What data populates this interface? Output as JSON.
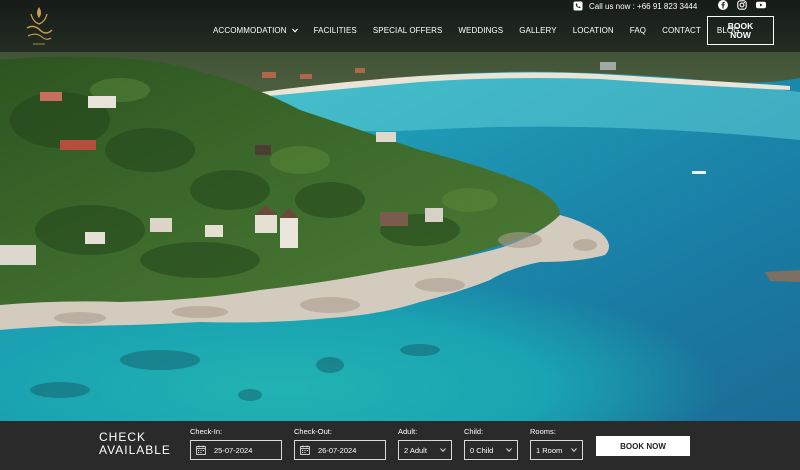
{
  "header": {
    "phone_text": "Call us now : +66 91 823 3444",
    "book_now_label": "BOOK\nNOW",
    "nav": [
      {
        "label": "ACCOMMODATION",
        "has_dropdown": true
      },
      {
        "label": "FACILITIES"
      },
      {
        "label": "SPECIAL OFFERS"
      },
      {
        "label": "WEDDINGS"
      },
      {
        "label": "GALLERY"
      },
      {
        "label": "LOCATION"
      },
      {
        "label": "FAQ"
      },
      {
        "label": "CONTACT"
      },
      {
        "label": "BLOG"
      }
    ],
    "socials": [
      "facebook-icon",
      "instagram-icon",
      "youtube-icon"
    ]
  },
  "booking": {
    "title": "CHECK\nAVAILABLE",
    "check_in": {
      "label": "Check-In:",
      "value": "25-07-2024"
    },
    "check_out": {
      "label": "Check-Out:",
      "value": "26-07-2024"
    },
    "adult": {
      "label": "Adult:",
      "value": "2 Adult"
    },
    "child": {
      "label": "Child:",
      "value": "0 Child"
    },
    "rooms": {
      "label": "Rooms:",
      "value": "1 Room"
    },
    "book_button": "BOOK NOW"
  },
  "colors": {
    "topbar": "#1a1e1c",
    "booking_bar": "#2a2a2a",
    "sea_deep": "#1d6f9a",
    "sea_shallow": "#24b5c0",
    "forest": "#2f5a25",
    "rock": "#d8cfc4"
  }
}
